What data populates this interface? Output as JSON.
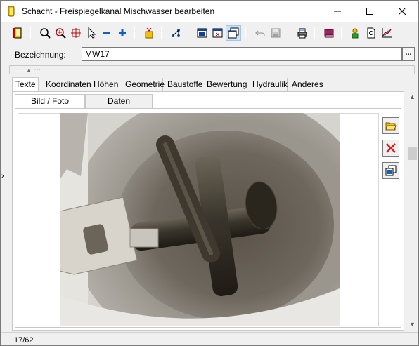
{
  "window": {
    "title": "Schacht - Freispiegelkanal Mischwasser bearbeiten"
  },
  "toolbar": {
    "buttons": [
      "exit-icon",
      "zoom-icon",
      "zoom-area-icon",
      "crosshair-icon",
      "pointer-icon",
      "minus-icon",
      "plus-icon",
      "wizard-icon",
      "network-icon",
      "window-1-icon",
      "window-2-icon",
      "window-3-icon",
      "undo-icon",
      "save-icon",
      "printer-icon",
      "book-icon",
      "user-icon",
      "document-icon",
      "chart-icon"
    ]
  },
  "field": {
    "label": "Bezeichnung:",
    "value": "MW17",
    "more_label": "..."
  },
  "tabs": [
    {
      "label": "Texte",
      "active": true
    },
    {
      "label": "Koordinaten"
    },
    {
      "label": "Höhen"
    },
    {
      "label": "Geometrie"
    },
    {
      "label": "Baustoffe"
    },
    {
      "label": "Bewertung"
    },
    {
      "label": "Hydraulik"
    },
    {
      "label": "Anderes"
    }
  ],
  "subtabs": [
    {
      "label": "Bild / Foto",
      "active": true
    },
    {
      "label": "Daten"
    }
  ],
  "side_buttons": [
    "open-folder-icon",
    "delete-icon",
    "image-edit-icon"
  ],
  "status": {
    "text": "17/62"
  },
  "colors": {
    "accent_blue": "#1060c0",
    "delete_red": "#d02020",
    "tab_active_bg": "#ffffff"
  }
}
